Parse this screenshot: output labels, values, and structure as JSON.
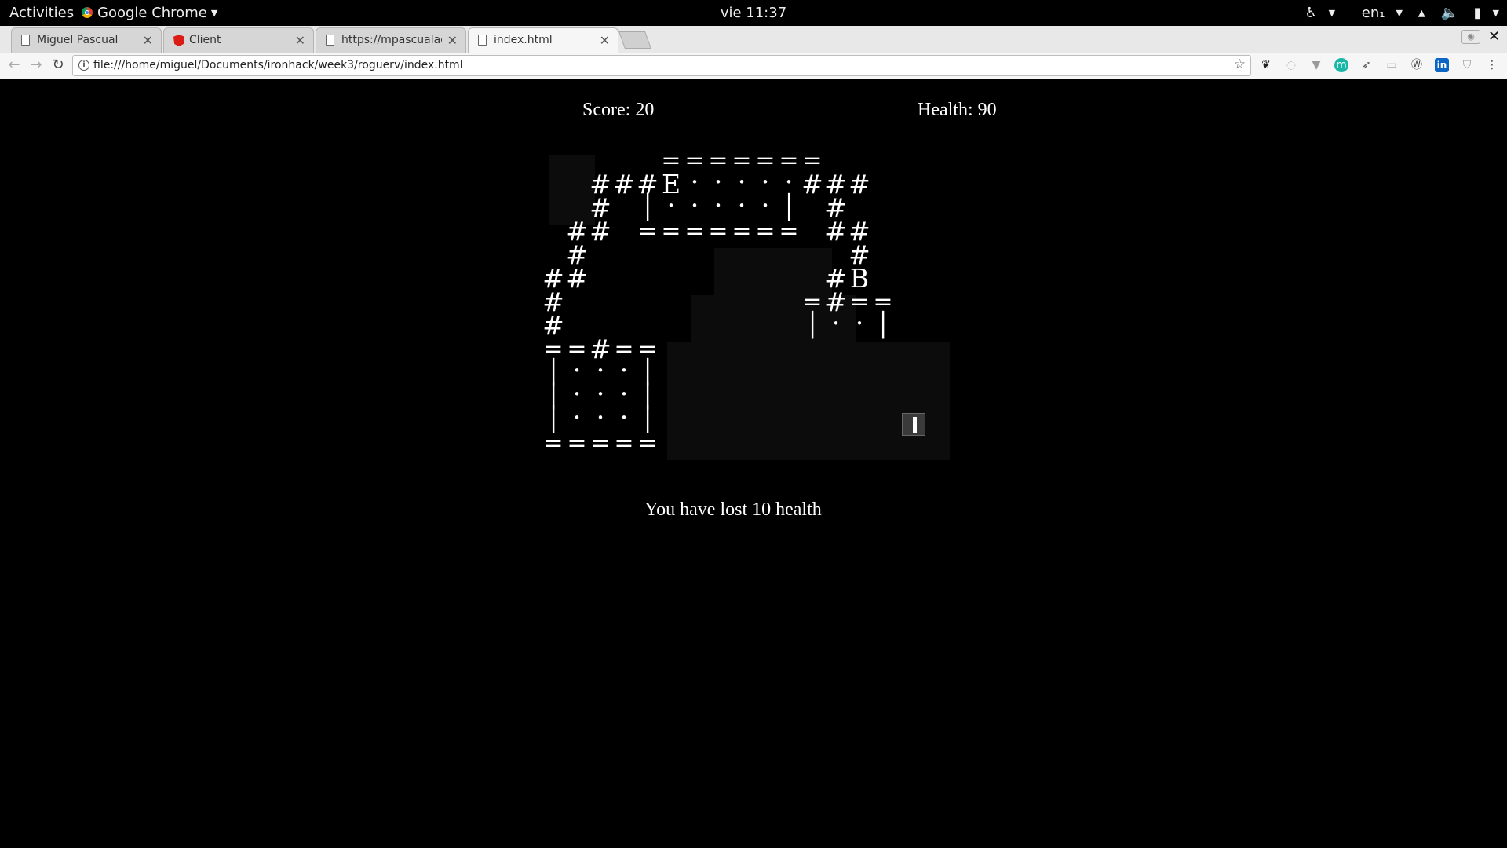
{
  "topbar": {
    "activities": "Activities",
    "app_name": "Google Chrome",
    "clock": "vie 11:37",
    "input_source": "en₁"
  },
  "tabs": [
    {
      "label": "Miguel Pascual",
      "icon": "page-icon"
    },
    {
      "label": "Client",
      "icon": "angular-icon"
    },
    {
      "label": "https://mpascualac",
      "icon": "page-icon"
    },
    {
      "label": "index.html",
      "icon": "page-icon",
      "active": true
    }
  ],
  "address_bar": {
    "url": "file:///home/miguel/Documents/ironhack/week3/roguerv/index.html"
  },
  "game": {
    "score_text": "Score: 20",
    "health_text": "Health: 90",
    "message": "You have lost 10 health",
    "score": 20,
    "health": 90,
    "map_rows": [
      "     =======     ",
      "  ###E:::::###   ",
      "  # |:::::| #    ",
      " ## ======= ##   ",
      " #           #   ",
      "##          #B   ",
      "#          =#==  ",
      "#          |::|  ",
      "==#==            ",
      "|:::|            ",
      "|:::|            ",
      "|:::|        @   ",
      "=====            "
    ]
  },
  "colors": {
    "background": "#000000",
    "text": "#ffffff",
    "fog": "#0c0c0c",
    "player": "#3a3a3a"
  }
}
